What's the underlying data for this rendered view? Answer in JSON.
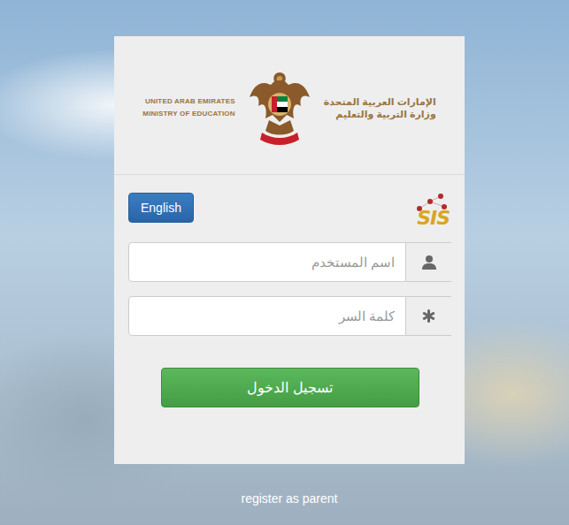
{
  "header": {
    "ministry_en": [
      "UNITED ARAB EMIRATES",
      "MINISTRY OF EDUCATION"
    ],
    "ministry_ar": [
      "الإمارات العربية المتحدة",
      "وزارة التربية والتعليم"
    ]
  },
  "language_button": "English",
  "logo": "SIS",
  "fields": [
    {
      "kind": "text",
      "placeholder": "اسم المستخدم"
    },
    {
      "kind": "password",
      "placeholder": "كلمة السر"
    }
  ],
  "login_button": "تسجيل الدخول",
  "register_link": "register as parent"
}
